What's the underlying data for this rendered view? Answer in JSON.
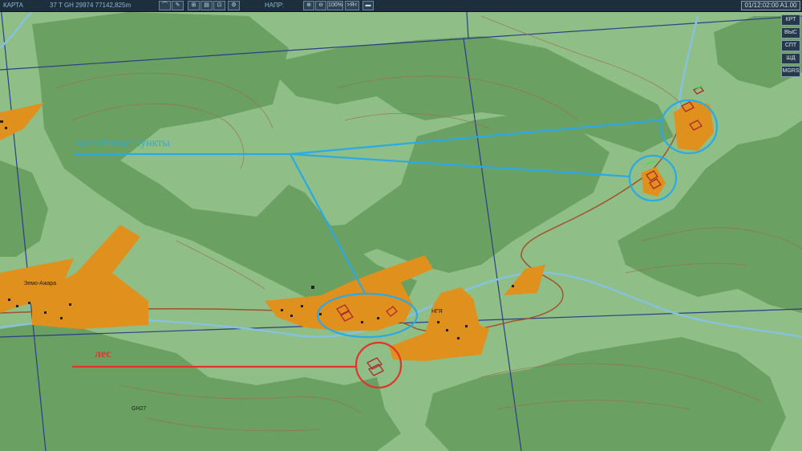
{
  "topbar": {
    "mode": "КАРТА",
    "coords": "37 T GH 29974 77142,825m",
    "direction_label": "НАПР:",
    "zoom": "100%",
    "ya_button": ">Я<",
    "time": "01/12:02:00 A1.00"
  },
  "right_panel": {
    "buttons": [
      "КРТ",
      "ВЫС",
      "СПТ",
      "ШД",
      "MGRS"
    ]
  },
  "annotations": {
    "settlements": "населённые пункты",
    "forest": "лес"
  },
  "map": {
    "town_label": "Земо-Ажара",
    "grid_label": "GH27",
    "village_label": "НГЯ",
    "colors": {
      "open_ground": "#8fbf86",
      "forest": "#6aa062",
      "settlement": "#e0901c",
      "river": "#86c2dc",
      "annotation_blue": "#2aa9e6",
      "annotation_red": "#e0352f"
    }
  }
}
